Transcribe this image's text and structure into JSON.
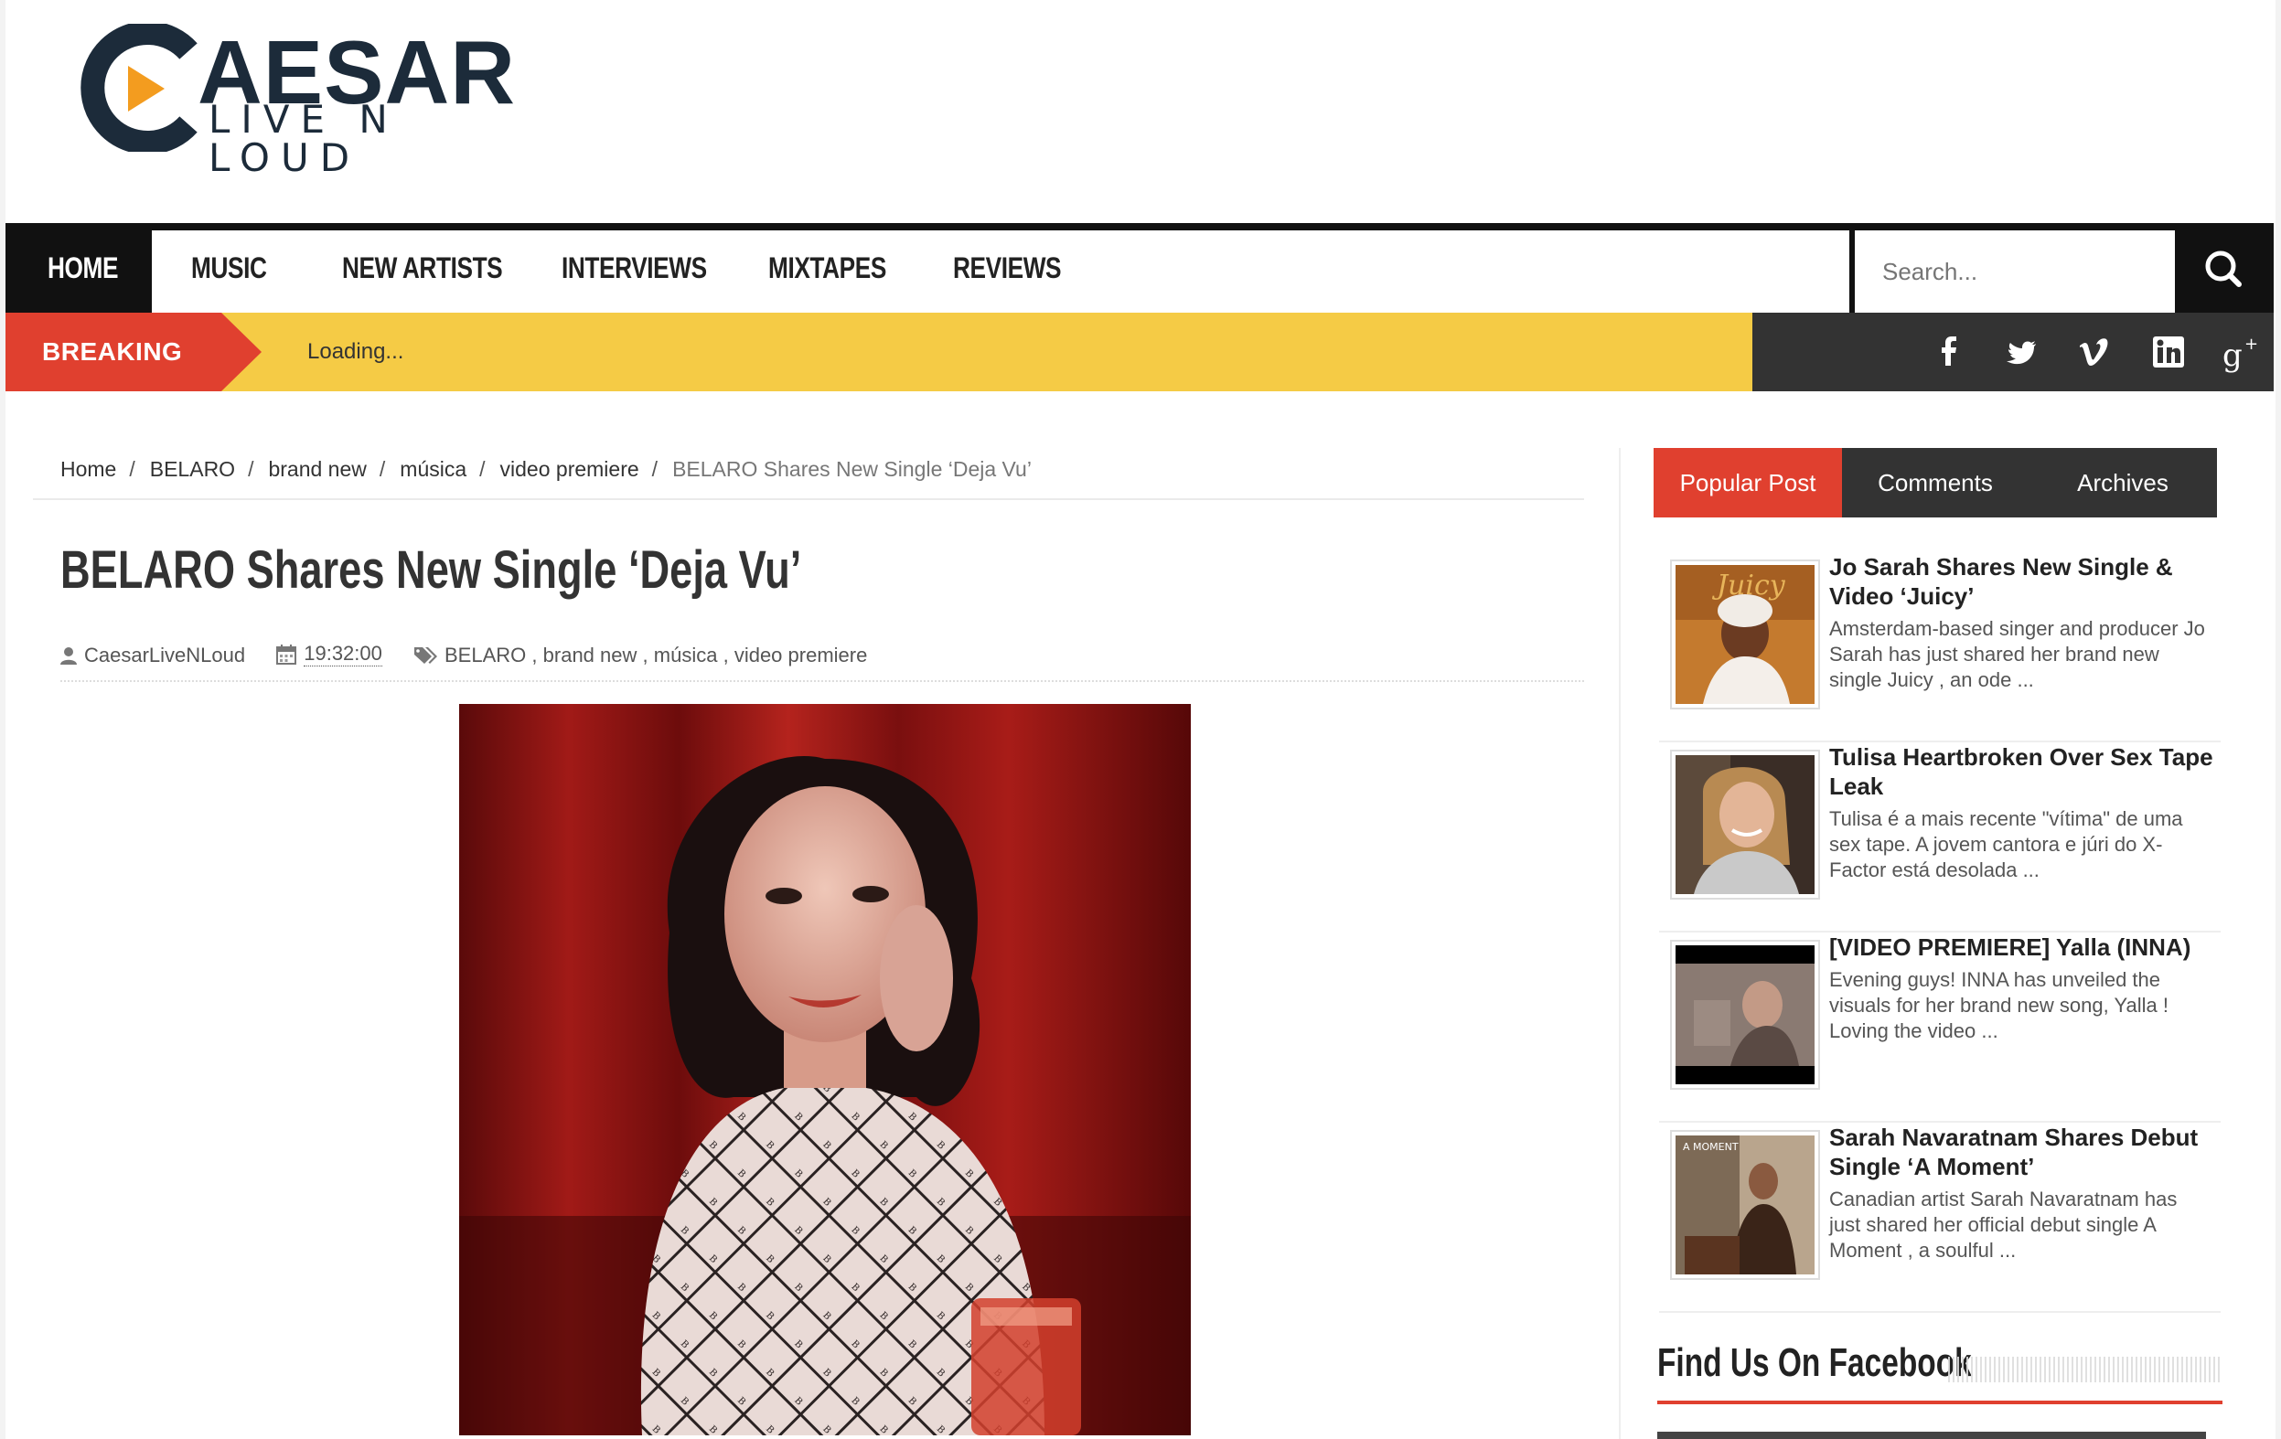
{
  "site": {
    "logo_word": "AESAR",
    "logo_tagline": "LIVE N LOUD",
    "logo_letter": "C"
  },
  "nav": {
    "items": [
      "HOME",
      "MUSIC",
      "NEW ARTISTS",
      "INTERVIEWS",
      "MIXTAPES",
      "REVIEWS"
    ],
    "search_placeholder": "Search..."
  },
  "breaking": {
    "label": "BREAKING",
    "text": "Loading..."
  },
  "social_icons": [
    "facebook-icon",
    "twitter-icon",
    "vimeo-icon",
    "linkedin-icon",
    "google-plus-icon"
  ],
  "breadcrumb": {
    "items": [
      "Home",
      "BELARO",
      "brand new",
      "música",
      "video premiere"
    ],
    "separator": "/",
    "current": "BELARO Shares New Single ‘Deja Vu’"
  },
  "post": {
    "title": "BELARO Shares New Single ‘Deja Vu’",
    "author": "CaesarLiveNLoud",
    "time": "19:32:00",
    "labels": [
      "BELARO",
      "brand new",
      "música",
      "video premiere"
    ],
    "label_separator": ","
  },
  "sidebar": {
    "tabs": [
      "Popular Post",
      "Comments",
      "Archives"
    ],
    "active_tab": "Popular Post",
    "popular": [
      {
        "title": "Jo Sarah Shares New Single & Video ‘Juicy’",
        "snippet": "Amsterdam-based singer and producer Jo Sarah has just shared her brand new single Juicy , an ode ..."
      },
      {
        "title": "Tulisa Heartbroken Over Sex Tape Leak",
        "snippet": "Tulisa é a mais recente \"vítima\" de uma sex tape. A jovem cantora e júri do X-Factor está desolada ..."
      },
      {
        "title": "[VIDEO PREMIERE] Yalla (INNA)",
        "snippet": "Evening guys! INNA has unveiled the visuals for her brand new song, Yalla ! Loving the video ..."
      },
      {
        "title": "Sarah Navaratnam Shares Debut Single ‘A Moment’",
        "snippet": "Canadian artist Sarah Navaratnam has just shared her official debut single A Moment , a soulful ..."
      }
    ],
    "facebook_heading": "Find Us On Facebook"
  },
  "thumbs": {
    "thumb1_text": "Juicy",
    "thumb4_text": "A MOMENT"
  },
  "colors": {
    "accent_red": "#e0402f",
    "breaking_yellow": "#f5cb45",
    "nav_black": "#111111",
    "logo_orange": "#f39c1f",
    "logo_navy": "#1c2b3a"
  }
}
